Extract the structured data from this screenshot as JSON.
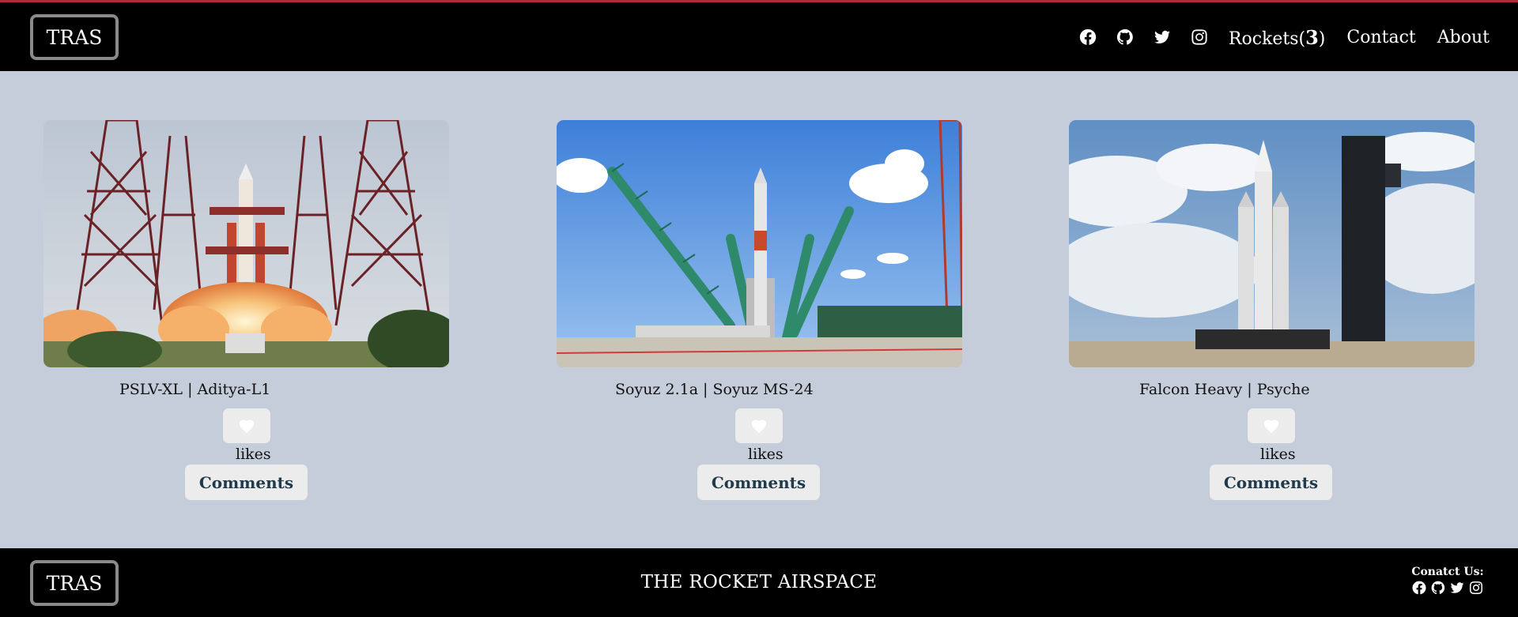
{
  "header": {
    "logo": "TRAS",
    "social_icons": [
      "facebook-icon",
      "github-icon",
      "twitter-icon",
      "instagram-icon"
    ],
    "nav": {
      "rockets_label": "Rockets(",
      "rockets_count": "3",
      "rockets_close": ")",
      "contact": "Contact",
      "about": "About"
    }
  },
  "cards": [
    {
      "title": "PSLV-XL | Aditya-L1",
      "likes_label": "likes",
      "comments_label": "Comments",
      "image": "pslv-launch"
    },
    {
      "title": "Soyuz 2.1a | Soyuz MS-24",
      "likes_label": "likes",
      "comments_label": "Comments",
      "image": "soyuz-pad"
    },
    {
      "title": "Falcon Heavy | Psyche",
      "likes_label": "likes",
      "comments_label": "Comments",
      "image": "falcon-heavy-pad"
    }
  ],
  "footer": {
    "logo": "TRAS",
    "tagline": "THE ROCKET AIRSPACE",
    "contact_label": "Conatct Us:",
    "social_icons": [
      "facebook-icon",
      "github-icon",
      "twitter-icon",
      "instagram-icon"
    ]
  },
  "colors": {
    "page_bg": "#c5ccda",
    "bar_bg": "#000000",
    "accent_top": "#b22a3a",
    "button_bg": "#ececec",
    "comments_text": "#1f3a4a"
  }
}
